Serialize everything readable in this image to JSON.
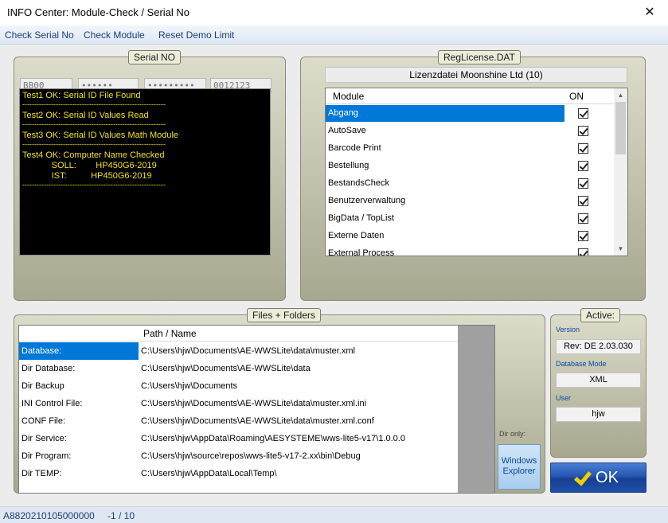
{
  "window": {
    "title": "INFO Center: Module-Check / Serial No",
    "close_glyph": "✕"
  },
  "menu": [
    "Check Serial No",
    "Check Module",
    "Reset Demo Limit"
  ],
  "serial": {
    "title": "Serial NO",
    "fields": [
      "BB00",
      "••••••",
      "•••••••••",
      "0012123"
    ],
    "console": {
      "separator": "------------------------------------------------------------",
      "lines": [
        "Test1 OK: Serial ID File Found",
        "Test2 OK: Serial ID Values Read",
        "Test3 OK: Serial ID Values Math Module",
        "Test4 OK: Computer Name Checked",
        "            SOLL:        HP450G6-2019",
        "            IST:          HP450G6-2019"
      ]
    }
  },
  "license": {
    "title": "RegLicense.DAT",
    "file_label": "Lizenzdatei Moonshine Ltd (10)",
    "columns": [
      "Module",
      "ON"
    ],
    "modules": [
      {
        "name": "Abgang",
        "on": true,
        "selected": true
      },
      {
        "name": "AutoSave",
        "on": true
      },
      {
        "name": "Barcode Print",
        "on": true
      },
      {
        "name": "Bestellung",
        "on": true
      },
      {
        "name": "BestandsCheck",
        "on": true
      },
      {
        "name": "Benutzerverwaltung",
        "on": true
      },
      {
        "name": "BigData / TopList",
        "on": true
      },
      {
        "name": "Externe Daten",
        "on": true
      },
      {
        "name": "External Process",
        "on": true
      }
    ]
  },
  "files": {
    "title": "Files + Folders",
    "column": "Path / Name",
    "rows": [
      {
        "label": "Database:",
        "path": "C:\\Users\\hjw\\Documents\\AE-WWSLite\\data\\muster.xml",
        "selected": true
      },
      {
        "label": "Dir Database:",
        "path": "C:\\Users\\hjw\\Documents\\AE-WWSLite\\data"
      },
      {
        "label": "Dir Backup",
        "path": "C:\\Users\\hjw\\Documents"
      },
      {
        "label": "INI Control File:",
        "path": "C:\\Users\\hjw\\Documents\\AE-WWSLite\\data\\muster.xml.ini"
      },
      {
        "label": "CONF File:",
        "path": "C:\\Users\\hjw\\Documents\\AE-WWSLite\\data\\muster.xml.conf"
      },
      {
        "label": "Dir Service:",
        "path": "C:\\Users\\hjw\\AppData\\Roaming\\AESYSTEME\\wws-lite5-v17\\1.0.0.0"
      },
      {
        "label": "Dir Program:",
        "path": "C:\\Users\\hjw\\source\\repos\\wws-lite5-v17-2.xx\\bin\\Debug"
      },
      {
        "label": "Dir TEMP:",
        "path": "C:\\Users\\hjw\\AppData\\Local\\Temp\\"
      }
    ],
    "dir_only": "Dir only:",
    "explorer_button": [
      "Windows",
      "Explorer"
    ]
  },
  "active": {
    "title": "Active:",
    "version_label": "Version",
    "version": "Rev: DE 2.03.030",
    "mode_label": "Database Mode",
    "mode": "XML",
    "user_label": "User",
    "user": "hjw"
  },
  "ok_label": "OK",
  "status": {
    "id": "A8820210105000000",
    "counter": "-1 / 10"
  },
  "colors": {
    "selection": "#0078d7",
    "console_text": "#f0e020",
    "ok_button": "#2556b0",
    "menu_text": "#1f3e78"
  }
}
